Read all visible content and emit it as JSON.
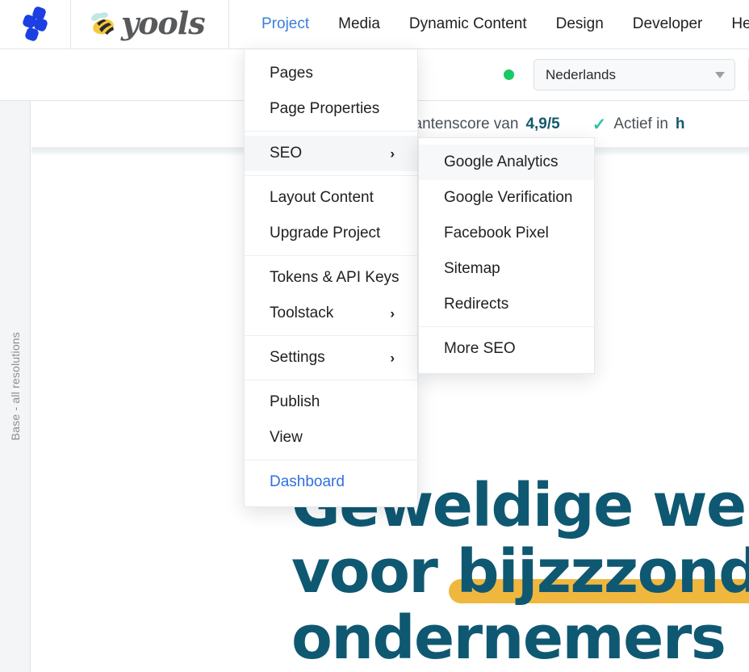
{
  "app": {
    "logo_icon": "yools-diamond-logo",
    "brand_icon": "bee-icon",
    "brand_name": "yools"
  },
  "nav": {
    "items": [
      {
        "label": "Project",
        "active": true
      },
      {
        "label": "Media",
        "active": false
      },
      {
        "label": "Dynamic Content",
        "active": false
      },
      {
        "label": "Design",
        "active": false
      },
      {
        "label": "Developer",
        "active": false
      },
      {
        "label": "He",
        "active": false
      }
    ]
  },
  "toolbar": {
    "status_dot_color": "#18c964",
    "language": {
      "value": "Nederlands",
      "caret_icon": "chevron-down-icon"
    }
  },
  "rail": {
    "label": "Base - all resolutions"
  },
  "menu": {
    "items": [
      {
        "label": "Pages",
        "submenu": false,
        "selected": false,
        "link": false,
        "sep_after": false
      },
      {
        "label": "Page Properties",
        "submenu": false,
        "selected": false,
        "link": false,
        "sep_after": true
      },
      {
        "label": "SEO",
        "submenu": true,
        "selected": true,
        "link": false,
        "sep_after": true
      },
      {
        "label": "Layout Content",
        "submenu": false,
        "selected": false,
        "link": false,
        "sep_after": false
      },
      {
        "label": "Upgrade Project",
        "submenu": false,
        "selected": false,
        "link": false,
        "sep_after": true
      },
      {
        "label": "Tokens & API Keys",
        "submenu": false,
        "selected": false,
        "link": false,
        "sep_after": false
      },
      {
        "label": "Toolstack",
        "submenu": true,
        "selected": false,
        "link": false,
        "sep_after": true
      },
      {
        "label": "Settings",
        "submenu": true,
        "selected": false,
        "link": false,
        "sep_after": true
      },
      {
        "label": "Publish",
        "submenu": false,
        "selected": false,
        "link": false,
        "sep_after": false
      },
      {
        "label": "View",
        "submenu": false,
        "selected": false,
        "link": false,
        "sep_after": true
      },
      {
        "label": "Dashboard",
        "submenu": false,
        "selected": false,
        "link": true,
        "sep_after": false
      }
    ],
    "chevron_icon": "chevron-right-icon"
  },
  "submenu": {
    "items": [
      {
        "label": "Google Analytics",
        "selected": true,
        "sep_after": false
      },
      {
        "label": "Google Verification",
        "selected": false,
        "sep_after": false
      },
      {
        "label": "Facebook Pixel",
        "selected": false,
        "sep_after": false
      },
      {
        "label": "Sitemap",
        "selected": false,
        "sep_after": false
      },
      {
        "label": "Redirects",
        "selected": false,
        "sep_after": true
      },
      {
        "label": "More SEO",
        "selected": false,
        "sep_after": false
      }
    ]
  },
  "site": {
    "usps": [
      {
        "check_icon": "check-icon",
        "text_before": "Klantenscore van ",
        "bold": "4,9/5",
        "text_after": ""
      },
      {
        "check_icon": "check-icon",
        "text_before": "Actief in ",
        "bold": "h",
        "text_after": ""
      }
    ],
    "hero": {
      "line1": "Geweldige web",
      "line2_pre": "voor ",
      "line2_highlight": "bijzzzonde",
      "line3": "ondernemers",
      "text_color": "#0f5872",
      "highlight_color": "#f0b73f"
    }
  }
}
